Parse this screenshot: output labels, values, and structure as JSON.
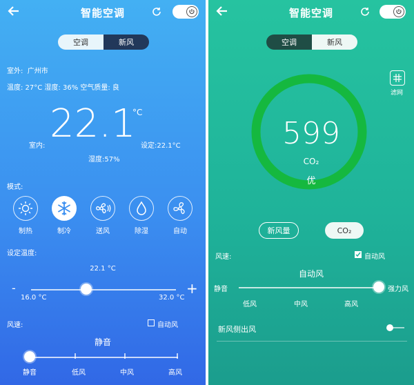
{
  "left": {
    "title": "智能空调",
    "tabs": [
      "空调",
      "新风"
    ],
    "location_label": "室外:",
    "location_value": "广州市",
    "outdoor_info": "温度: 27°C   湿度: 36%   空气质量: 良",
    "temp_value": "22.1",
    "temp_unit": "°C",
    "indoor_label": "室内:",
    "set_label": "设定:22.1°C",
    "humidity": "湿度:57%",
    "mode_label": "模式:",
    "modes": [
      {
        "label": "制热",
        "icon": "sun-icon"
      },
      {
        "label": "制冷",
        "icon": "snowflake-icon"
      },
      {
        "label": "送风",
        "icon": "fan-blow-icon"
      },
      {
        "label": "除湿",
        "icon": "droplet-icon"
      },
      {
        "label": "自动",
        "icon": "fan-icon"
      }
    ],
    "active_mode": "制冷",
    "set_temp_label": "设定温度:",
    "slider_value": "22.1 °C",
    "slider_min": "16.0 °C",
    "slider_max": "32.0 °C",
    "minus": "-",
    "plus": "+",
    "slider_level": 0.38,
    "wind_label": "风速:",
    "auto_wind": "自动风",
    "wind_current": "静音",
    "wind_levels": [
      "静音",
      "低风",
      "中风",
      "高风"
    ]
  },
  "right": {
    "title": "智能空调",
    "tabs": [
      "空调",
      "新风"
    ],
    "filter_label": "滤网",
    "co2_value": "599",
    "co2_unit": "CO₂",
    "quality": "优",
    "btn_fresh": "新风量",
    "btn_co2": "CO₂",
    "wind_label": "风速:",
    "auto_wind": "自动风",
    "wind_current": "自动风",
    "wind_min": "静音",
    "wind_max": "强力风",
    "wind_levels": [
      "低风",
      "中风",
      "高风"
    ],
    "side_label": "新风侧出风"
  },
  "colors": {
    "left_bg_top": "#43b0f3",
    "left_bg_bottom": "#3168e6",
    "right_bg": "#1fb39a",
    "ring": "#15b83f"
  }
}
